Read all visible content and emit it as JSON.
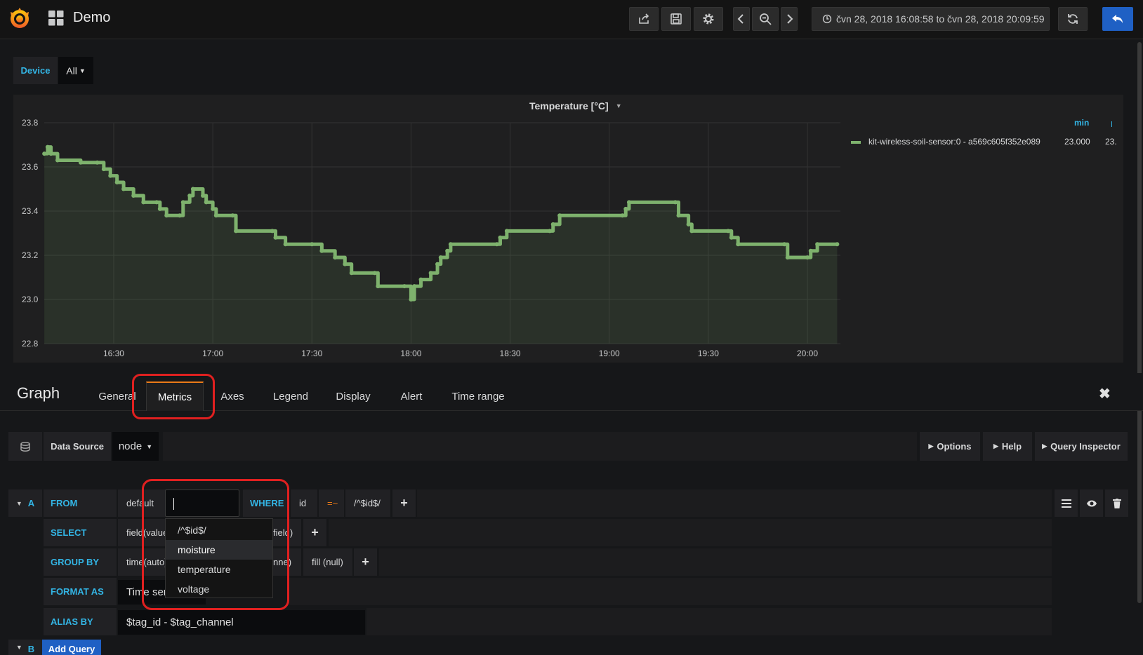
{
  "navbar": {
    "title": "Demo",
    "time_range": "čvn 28, 2018 16:08:58 to čvn 28, 2018 20:09:59"
  },
  "variables": {
    "device_label": "Device",
    "device_value": "All"
  },
  "panel": {
    "title": "Temperature [°C]",
    "legend": {
      "min_header": "min",
      "series_name": "kit-wireless-soil-sensor:0 - a569c605f352e089",
      "min_value": "23.000",
      "truncated_value": "23."
    }
  },
  "editor": {
    "title": "Graph",
    "tabs": [
      "General",
      "Metrics",
      "Axes",
      "Legend",
      "Display",
      "Alert",
      "Time range"
    ],
    "active_tab": "Metrics",
    "datasource_label": "Data Source",
    "datasource_value": "node",
    "options": "Options",
    "help": "Help",
    "query_inspector": "Query Inspector"
  },
  "query_a": {
    "letter": "A",
    "from_label": "FROM",
    "from_policy": "default",
    "measurement_input": "",
    "where_label": "WHERE",
    "where_key": "id",
    "where_op": "=~",
    "where_value": "/^$id$/",
    "select_label": "SELECT",
    "select_field": "field(value)",
    "select_field_tail": "field)",
    "groupby_label": "GROUP BY",
    "groupby_time": "time(auto)",
    "groupby_tag_tail": "nne)",
    "groupby_fill": "fill (null)",
    "format_label": "FORMAT AS",
    "format_value": "Time series",
    "alias_label": "ALIAS BY",
    "alias_value": "$tag_id - $tag_channel"
  },
  "query_b": {
    "letter": "B",
    "add_query": "Add Query"
  },
  "measurement_dropdown": {
    "items": [
      "/^$id$/",
      "moisture",
      "temperature",
      "voltage"
    ],
    "highlighted": "moisture"
  },
  "colors": {
    "series": "#7eb26d",
    "accent_blue": "#33b5e5",
    "active_tab_border": "#eb7b18",
    "highlight_box": "#e02020",
    "back_button": "#1f60c4"
  },
  "chart_data": {
    "type": "area",
    "title": "Temperature [°C]",
    "xlabel": "",
    "ylabel": "",
    "x_tick_labels": [
      "16:30",
      "17:00",
      "17:30",
      "18:00",
      "18:30",
      "19:00",
      "19:30",
      "20:00"
    ],
    "y_tick_labels": [
      "23.8",
      "23.6",
      "23.4",
      "23.2",
      "23.0",
      "22.8"
    ],
    "ylim": [
      22.8,
      23.8
    ],
    "x_range": [
      "16:08:58",
      "20:09:59"
    ],
    "grid": true,
    "legend_position": "right",
    "series": [
      {
        "name": "kit-wireless-soil-sensor:0 - a569c605f352e089",
        "color": "#7eb26d",
        "points": [
          [
            "16:09",
            23.66
          ],
          [
            "16:10",
            23.69
          ],
          [
            "16:11",
            23.66
          ],
          [
            "16:13",
            23.63
          ],
          [
            "16:20",
            23.62
          ],
          [
            "16:25",
            23.62
          ],
          [
            "16:27",
            23.59
          ],
          [
            "16:29",
            23.56
          ],
          [
            "16:31",
            23.53
          ],
          [
            "16:33",
            23.5
          ],
          [
            "16:36",
            23.47
          ],
          [
            "16:39",
            23.44
          ],
          [
            "16:43",
            23.44
          ],
          [
            "16:44",
            23.41
          ],
          [
            "16:46",
            23.38
          ],
          [
            "16:50",
            23.38
          ],
          [
            "16:51",
            23.44
          ],
          [
            "16:53",
            23.47
          ],
          [
            "16:54",
            23.5
          ],
          [
            "16:57",
            23.47
          ],
          [
            "16:58",
            23.44
          ],
          [
            "17:00",
            23.41
          ],
          [
            "17:01",
            23.38
          ],
          [
            "17:06",
            23.38
          ],
          [
            "17:07",
            23.31
          ],
          [
            "17:18",
            23.31
          ],
          [
            "17:19",
            23.28
          ],
          [
            "17:22",
            23.25
          ],
          [
            "17:30",
            23.25
          ],
          [
            "17:33",
            23.22
          ],
          [
            "17:37",
            23.19
          ],
          [
            "17:40",
            23.16
          ],
          [
            "17:42",
            23.12
          ],
          [
            "17:49",
            23.12
          ],
          [
            "17:50",
            23.06
          ],
          [
            "17:58",
            23.06
          ],
          [
            "18:00",
            23.0
          ],
          [
            "18:01",
            23.06
          ],
          [
            "18:03",
            23.09
          ],
          [
            "18:06",
            23.12
          ],
          [
            "18:08",
            23.16
          ],
          [
            "18:09",
            23.19
          ],
          [
            "18:11",
            23.22
          ],
          [
            "18:12",
            23.25
          ],
          [
            "18:26",
            23.25
          ],
          [
            "18:27",
            23.28
          ],
          [
            "18:29",
            23.31
          ],
          [
            "18:42",
            23.31
          ],
          [
            "18:43",
            23.34
          ],
          [
            "18:45",
            23.38
          ],
          [
            "19:04",
            23.38
          ],
          [
            "19:05",
            23.41
          ],
          [
            "19:06",
            23.44
          ],
          [
            "19:20",
            23.44
          ],
          [
            "19:21",
            23.38
          ],
          [
            "19:24",
            23.34
          ],
          [
            "19:25",
            23.31
          ],
          [
            "19:36",
            23.31
          ],
          [
            "19:37",
            23.28
          ],
          [
            "19:39",
            23.25
          ],
          [
            "19:53",
            23.25
          ],
          [
            "19:54",
            23.19
          ],
          [
            "20:00",
            23.19
          ],
          [
            "20:01",
            23.22
          ],
          [
            "20:03",
            23.25
          ],
          [
            "20:09",
            23.25
          ]
        ]
      }
    ]
  }
}
